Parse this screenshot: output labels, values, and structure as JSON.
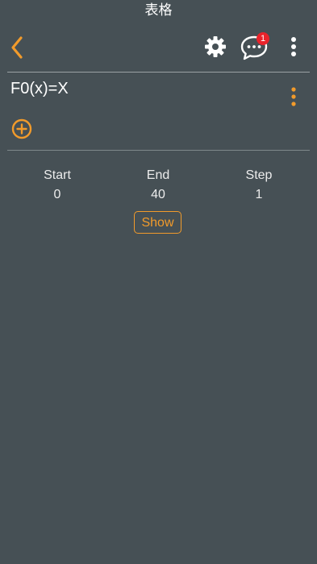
{
  "header": {
    "title": "表格",
    "notification_count": "1"
  },
  "function": {
    "label": "F0(x)=X"
  },
  "table": {
    "columns": [
      {
        "label": "Start",
        "value": "0"
      },
      {
        "label": "End",
        "value": "40"
      },
      {
        "label": "Step",
        "value": "1"
      }
    ],
    "show_label": "Show"
  },
  "colors": {
    "background": "#465055",
    "accent": "#f29b2b",
    "badge": "#e9232b"
  },
  "icons": [
    "back-icon",
    "gear-icon",
    "chat-icon",
    "more-vert-icon",
    "add-circle-icon"
  ]
}
